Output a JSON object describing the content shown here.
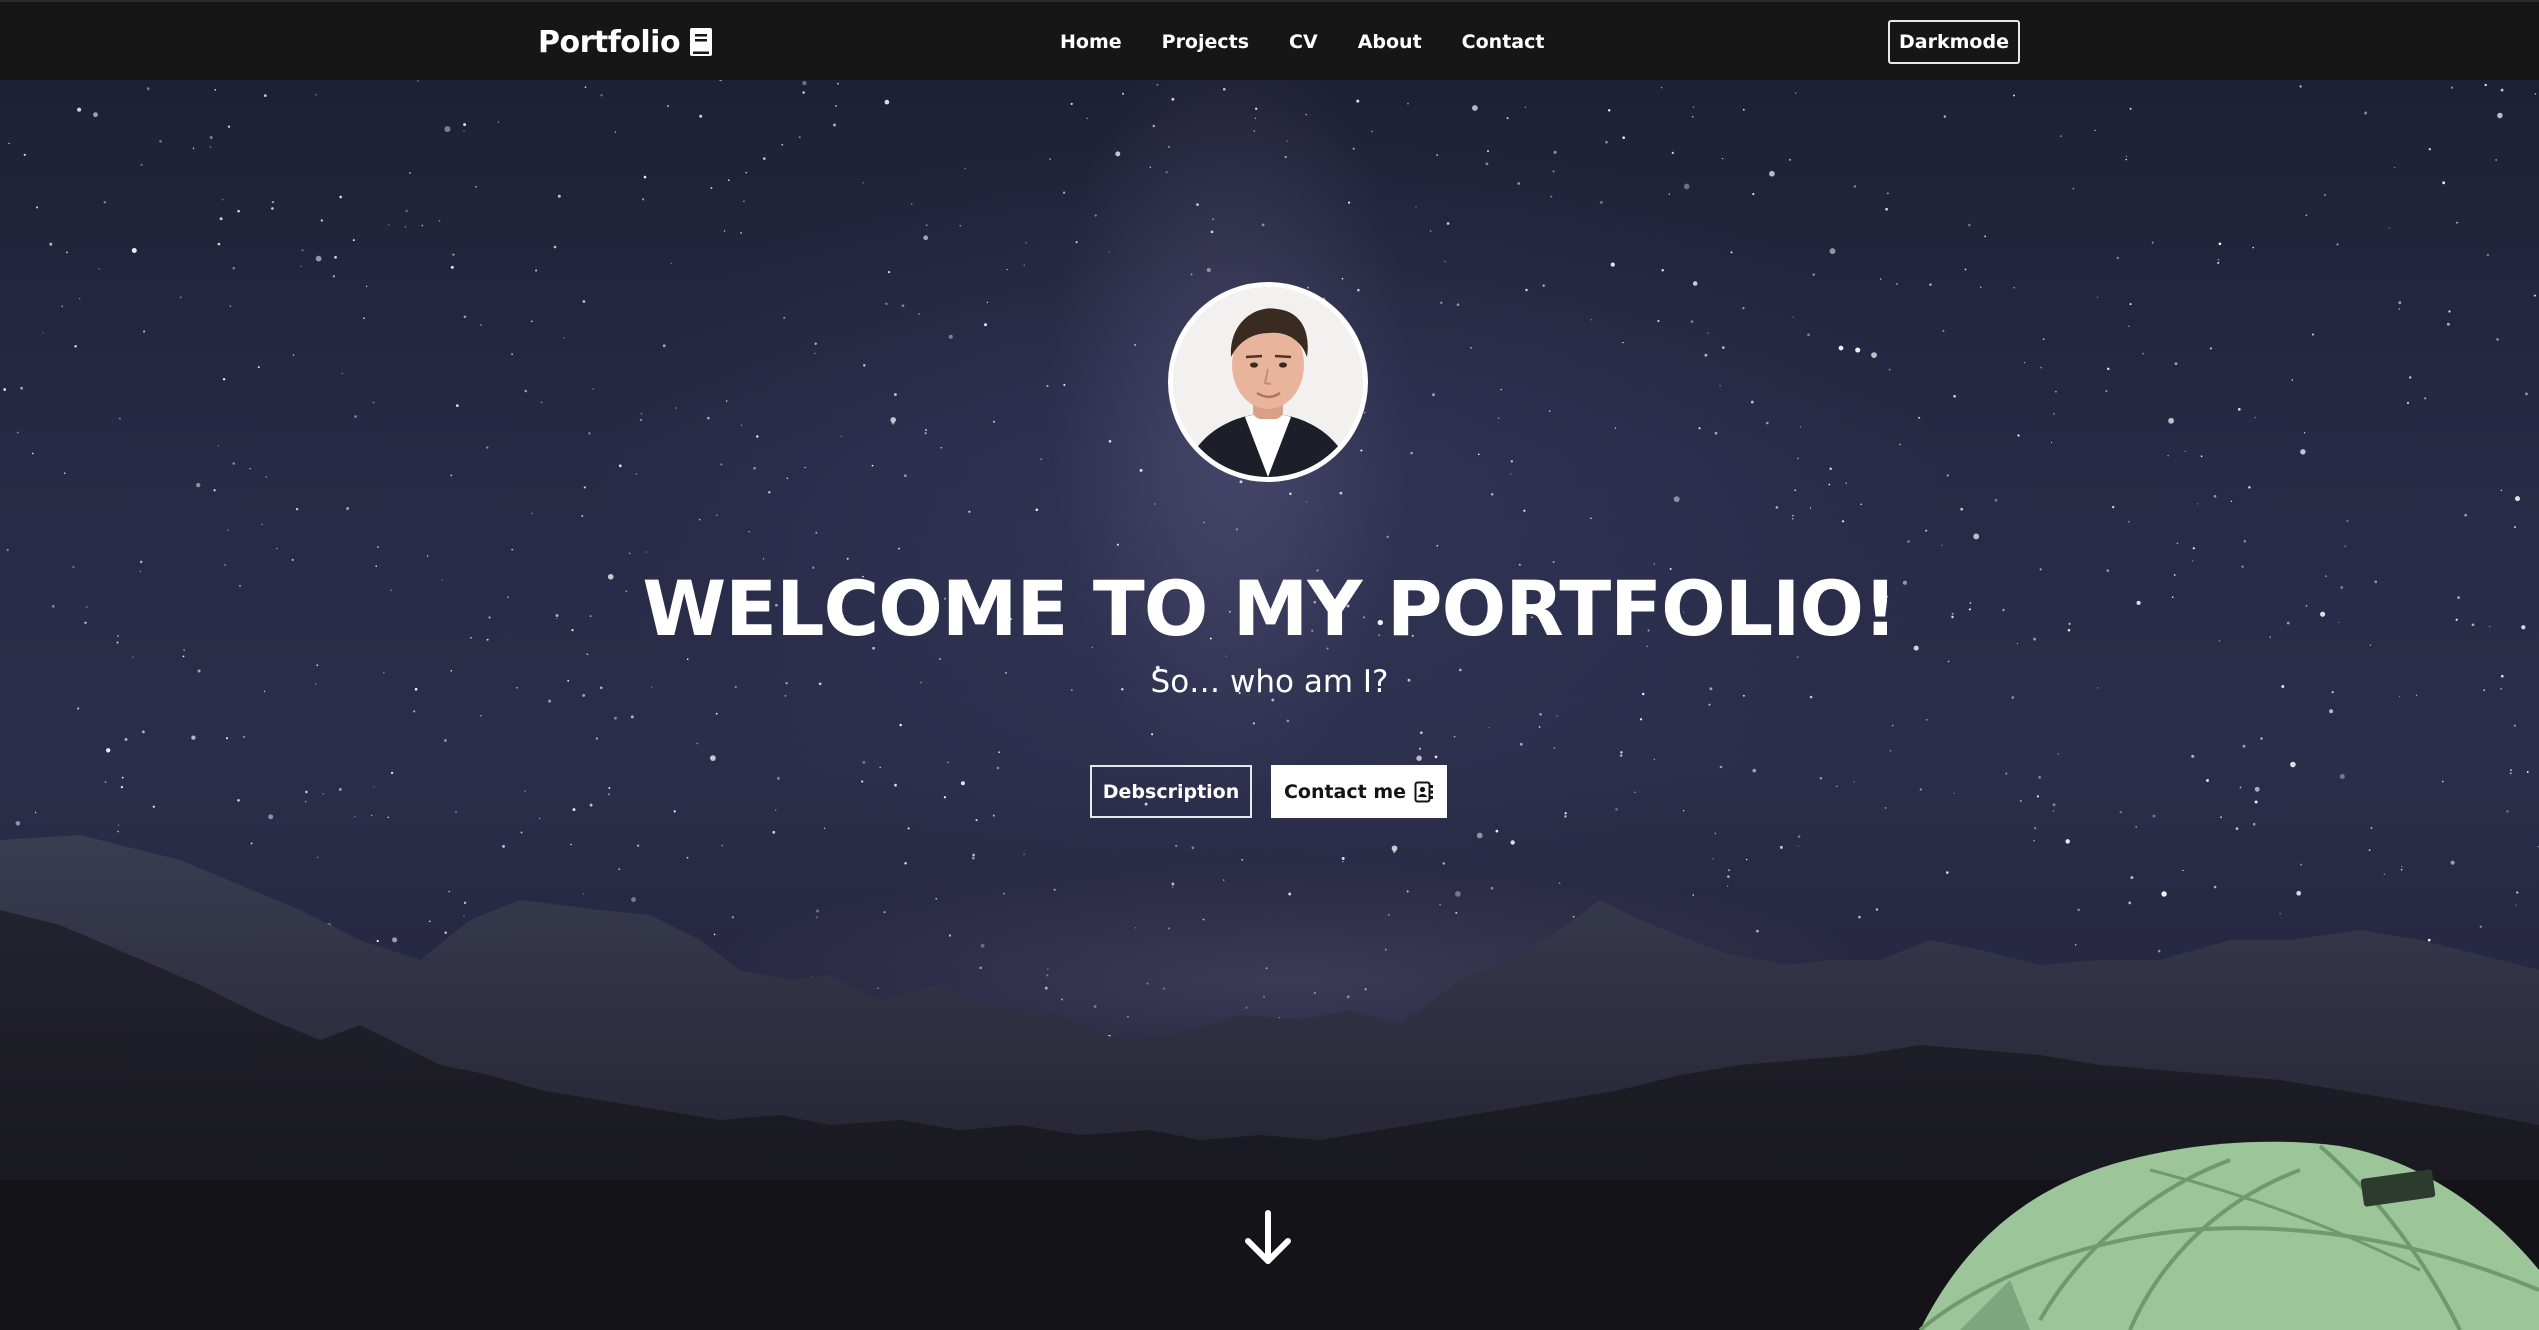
{
  "navbar": {
    "brand": "Portfolio",
    "brand_icon": "book-icon",
    "links": [
      {
        "label": "Home"
      },
      {
        "label": "Projects"
      },
      {
        "label": "CV"
      },
      {
        "label": "About"
      },
      {
        "label": "Contact"
      }
    ],
    "darkmode_label": "Darkmode"
  },
  "hero": {
    "title": "WELCOME TO MY PORTFOLIO!",
    "subtitle": "So… who am I?",
    "description_button": "Debscription",
    "contact_button": "Contact me",
    "contact_icon": "contact-card-icon",
    "scroll_icon": "arrow-down-icon",
    "avatar": "profile-photo"
  },
  "colors": {
    "navbar_bg": "#161616",
    "sky_top": "#1e2035",
    "sky_mid": "#2b2d4a",
    "mountains": "#1a1a22",
    "text": "#ffffff",
    "tent": "#9cc69a"
  }
}
